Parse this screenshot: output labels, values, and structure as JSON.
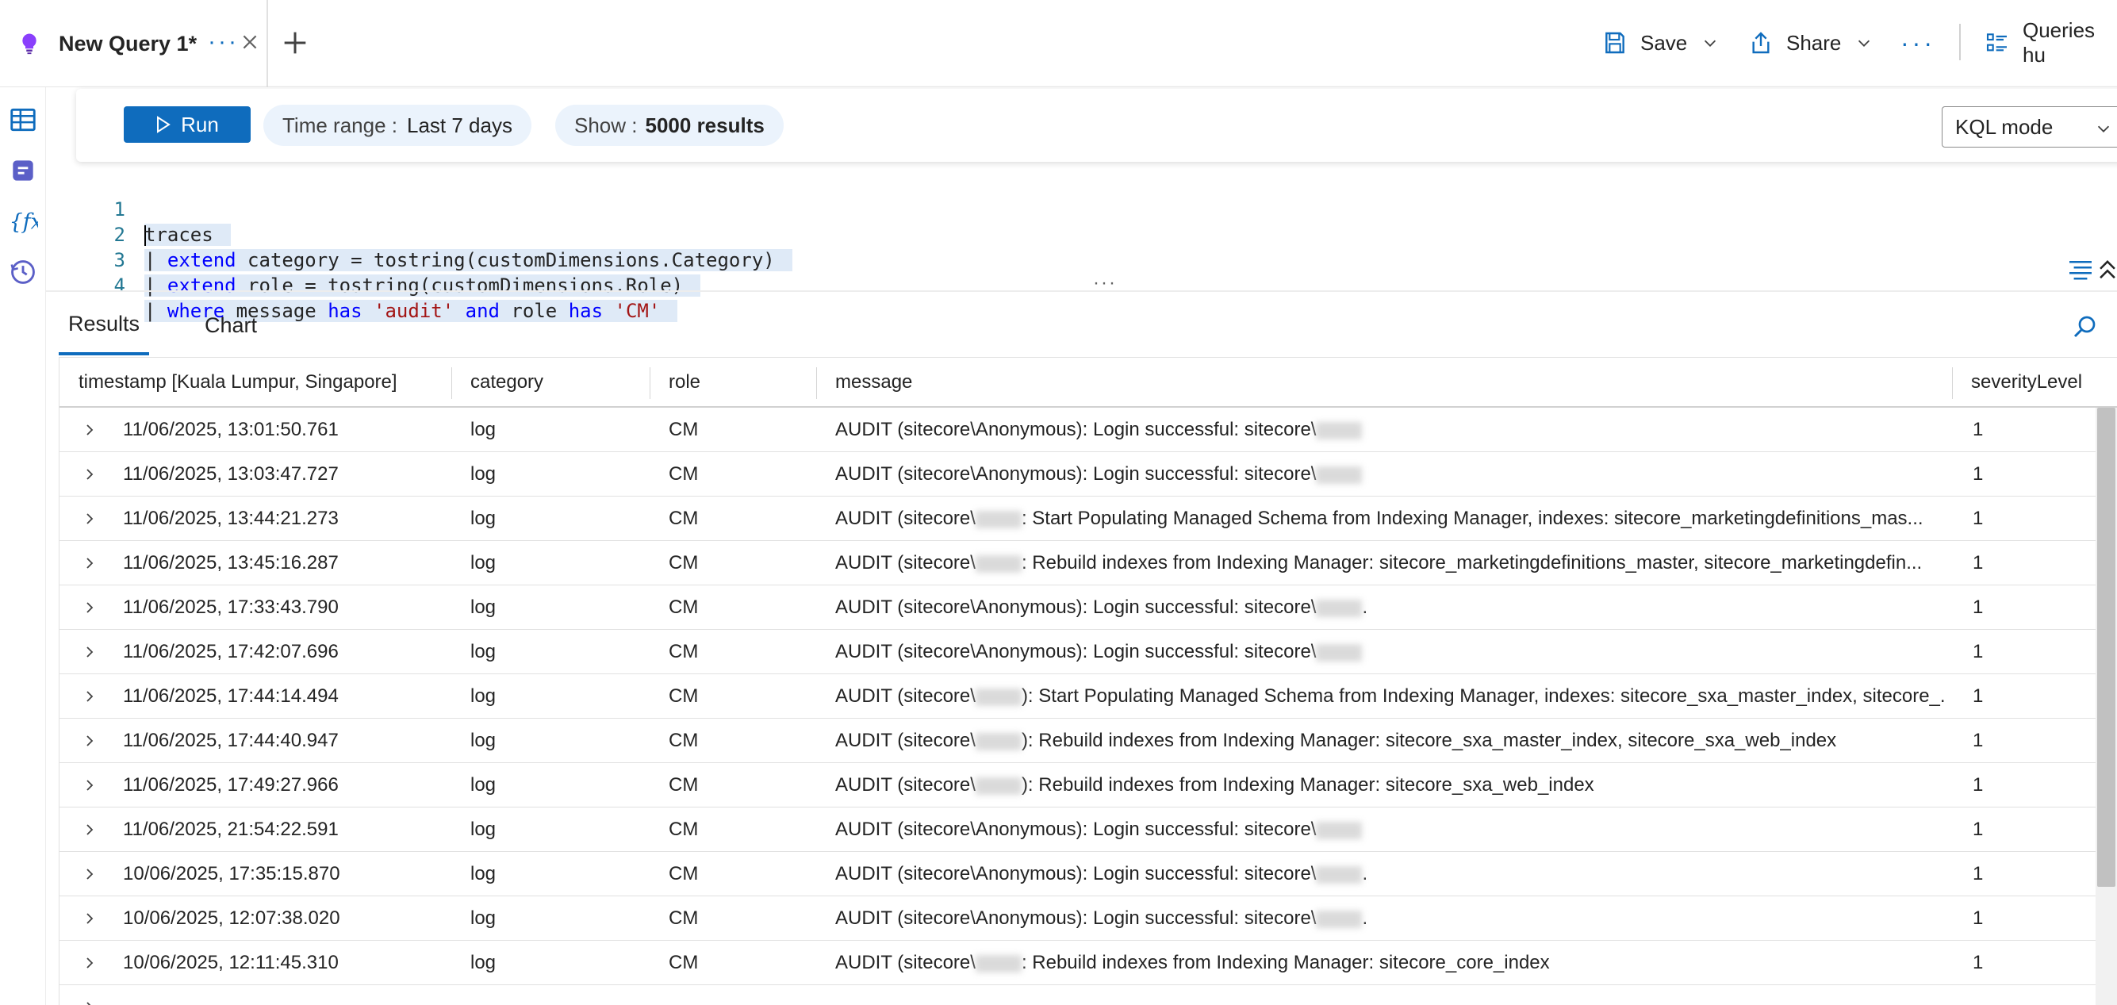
{
  "tab": {
    "title": "New Query 1*",
    "more": "···"
  },
  "commands": {
    "save": "Save",
    "share": "Share",
    "more": "···",
    "queries": "Queries hu"
  },
  "toolbar": {
    "run": "Run",
    "time_range_label": "Time range :",
    "time_range_value": "Last 7 days",
    "show_label": "Show :",
    "show_value": "5000 results",
    "mode": "KQL mode"
  },
  "editor": {
    "lines": [
      {
        "num": "1"
      },
      {
        "num": "2"
      },
      {
        "num": "3"
      },
      {
        "num": "4"
      }
    ],
    "tokens": {
      "l1": "traces",
      "l2a": "| ",
      "l2kw": "extend",
      "l2b": " category = tostring(customDimensions.Category)",
      "l3a": "| ",
      "l3kw": "extend",
      "l3b": " role = tostring(customDimensions.Role)",
      "l4a": "| ",
      "l4kw": "where",
      "l4b": " message ",
      "l4kw2": "has",
      "l4c": " ",
      "l4s1": "'audit'",
      "l4d": " ",
      "l4kw3": "and",
      "l4e": " role ",
      "l4kw4": "has",
      "l4f": " ",
      "l4s2": "'CM'"
    }
  },
  "results": {
    "tabs": [
      "Results",
      "Chart"
    ],
    "columns": [
      "timestamp [Kuala Lumpur, Singapore]",
      "category",
      "role",
      "message",
      "severityLevel"
    ],
    "rows": [
      {
        "timestamp": "11/06/2025, 13:01:50.761",
        "category": "log",
        "role": "CM",
        "msg_pre": "AUDIT (sitecore\\Anonymous): Login successful: sitecore\\",
        "msg_post": "",
        "severity": "1"
      },
      {
        "timestamp": "11/06/2025, 13:03:47.727",
        "category": "log",
        "role": "CM",
        "msg_pre": "AUDIT (sitecore\\Anonymous): Login successful: sitecore\\",
        "msg_post": "",
        "severity": "1"
      },
      {
        "timestamp": "11/06/2025, 13:44:21.273",
        "category": "log",
        "role": "CM",
        "msg_pre": "AUDIT (sitecore\\",
        "msg_post": ": Start Populating Managed Schema from Indexing Manager, indexes: sitecore_marketingdefinitions_mas...",
        "severity": "1"
      },
      {
        "timestamp": "11/06/2025, 13:45:16.287",
        "category": "log",
        "role": "CM",
        "msg_pre": "AUDIT (sitecore\\",
        "msg_post": ": Rebuild indexes from Indexing Manager: sitecore_marketingdefinitions_master, sitecore_marketingdefin...",
        "severity": "1"
      },
      {
        "timestamp": "11/06/2025, 17:33:43.790",
        "category": "log",
        "role": "CM",
        "msg_pre": "AUDIT (sitecore\\Anonymous): Login successful: sitecore\\",
        "msg_post": ".",
        "severity": "1"
      },
      {
        "timestamp": "11/06/2025, 17:42:07.696",
        "category": "log",
        "role": "CM",
        "msg_pre": "AUDIT (sitecore\\Anonymous): Login successful: sitecore\\",
        "msg_post": "",
        "severity": "1"
      },
      {
        "timestamp": "11/06/2025, 17:44:14.494",
        "category": "log",
        "role": "CM",
        "msg_pre": "AUDIT (sitecore\\",
        "msg_post": "): Start Populating Managed Schema from Indexing Manager, indexes: sitecore_sxa_master_index, sitecore_...",
        "severity": "1"
      },
      {
        "timestamp": "11/06/2025, 17:44:40.947",
        "category": "log",
        "role": "CM",
        "msg_pre": "AUDIT (sitecore\\",
        "msg_post": "): Rebuild indexes from Indexing Manager: sitecore_sxa_master_index, sitecore_sxa_web_index",
        "severity": "1"
      },
      {
        "timestamp": "11/06/2025, 17:49:27.966",
        "category": "log",
        "role": "CM",
        "msg_pre": "AUDIT (sitecore\\",
        "msg_post": "): Rebuild indexes from Indexing Manager: sitecore_sxa_web_index",
        "severity": "1"
      },
      {
        "timestamp": "11/06/2025, 21:54:22.591",
        "category": "log",
        "role": "CM",
        "msg_pre": "AUDIT (sitecore\\Anonymous): Login successful: sitecore\\",
        "msg_post": "",
        "severity": "1"
      },
      {
        "timestamp": "10/06/2025, 17:35:15.870",
        "category": "log",
        "role": "CM",
        "msg_pre": "AUDIT (sitecore\\Anonymous): Login successful: sitecore\\",
        "msg_post": ".",
        "severity": "1"
      },
      {
        "timestamp": "10/06/2025, 12:07:38.020",
        "category": "log",
        "role": "CM",
        "msg_pre": "AUDIT (sitecore\\Anonymous): Login successful: sitecore\\",
        "msg_post": ".",
        "severity": "1"
      },
      {
        "timestamp": "10/06/2025, 12:11:45.310",
        "category": "log",
        "role": "CM",
        "msg_pre": "AUDIT (sitecore\\",
        "msg_post": ": Rebuild indexes from Indexing Manager: sitecore_core_index",
        "severity": "1"
      }
    ]
  },
  "icons": {
    "tab": "lightbulb-icon",
    "close": "close-icon",
    "new_tab": "plus-icon",
    "save": "save-icon",
    "share": "share-icon",
    "queries": "queries-list-icon",
    "rail": [
      "tables-icon",
      "queries-icon",
      "functions-icon",
      "history-icon"
    ],
    "run": "play-icon",
    "search": "search-icon",
    "expand": "chevron-right-icon"
  },
  "colors": {
    "accent": "#0f6cbd",
    "selection": "#dfeaf7",
    "keyword": "#0000ff",
    "string": "#a31515",
    "line_number": "#237893",
    "tab_icon": "#8a3ffc"
  }
}
